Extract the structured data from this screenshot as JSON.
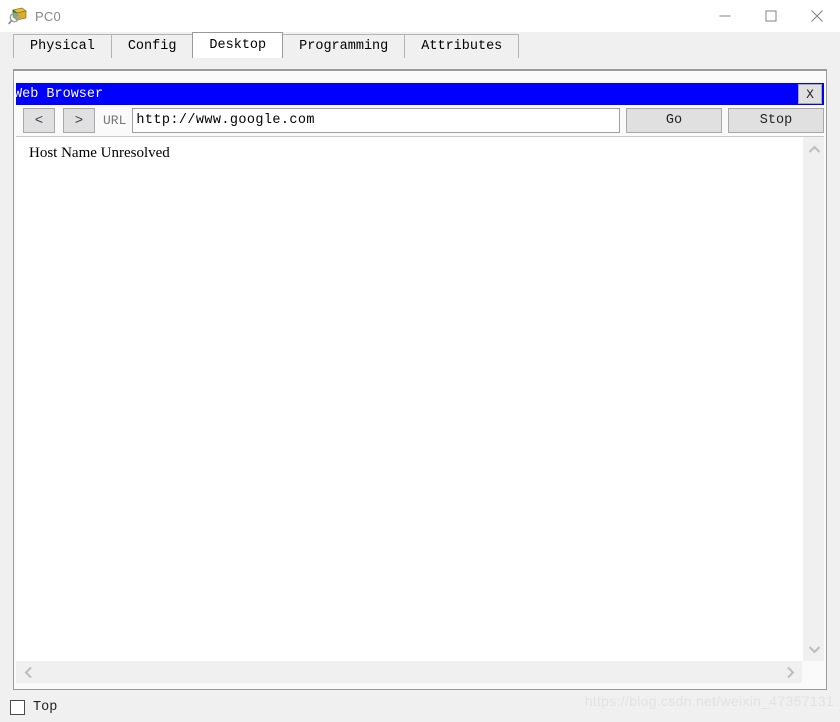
{
  "window": {
    "title": "PC0",
    "icon": "pc-device-icon",
    "controls": {
      "minimize": "minimize-icon",
      "maximize": "maximize-icon",
      "close": "close-icon"
    }
  },
  "tabs": [
    {
      "label": "Physical",
      "active": false
    },
    {
      "label": "Config",
      "active": false
    },
    {
      "label": "Desktop",
      "active": true
    },
    {
      "label": "Programming",
      "active": false
    },
    {
      "label": "Attributes",
      "active": false
    }
  ],
  "browser": {
    "title": "Web Browser",
    "close_label": "X",
    "toolbar": {
      "back_label": "<",
      "forward_label": ">",
      "url_label": "URL",
      "url_value": "http://www.google.com",
      "url_placeholder": "",
      "go_label": "Go",
      "stop_label": "Stop"
    },
    "content": {
      "message": "Host Name Unresolved"
    },
    "scrollbars": {
      "up": "chevron-up-icon",
      "down": "chevron-down-icon",
      "left": "chevron-left-icon",
      "right": "chevron-right-icon"
    }
  },
  "footer": {
    "checkbox_label": "Top",
    "checkbox_checked": false
  },
  "watermark": "https://blog.csdn.net/weixin_47357131",
  "colors": {
    "accent": "#0000ff",
    "window_bg": "#f0f0f0",
    "panel_bg": "#fafafa",
    "doc_bg": "#ffffff",
    "button_face": "#e0e0e0"
  }
}
